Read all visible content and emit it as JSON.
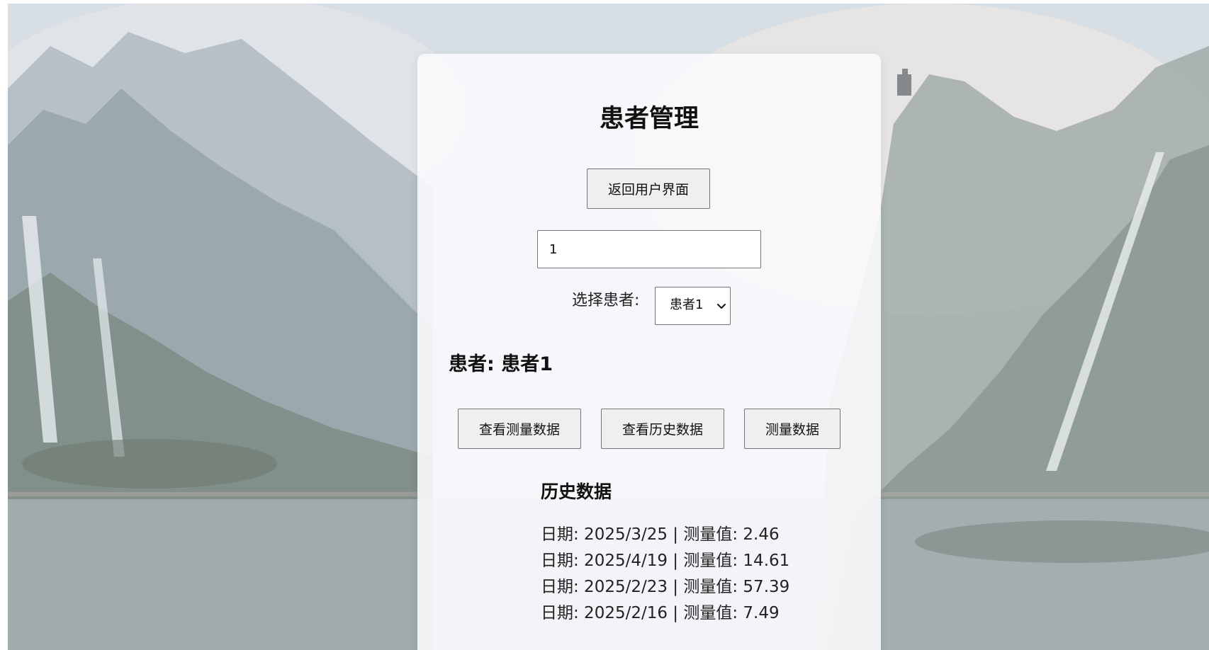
{
  "page": {
    "title": "患者管理"
  },
  "actions": {
    "back_label": "返回用户界面"
  },
  "id_input": {
    "value": "1"
  },
  "patient_select": {
    "label": "选择患者:",
    "selected": "患者1"
  },
  "patient": {
    "heading": "患者: 患者1"
  },
  "buttons": {
    "view_measurements": "查看测量数据",
    "view_history": "查看历史数据",
    "measure": "测量数据"
  },
  "history": {
    "heading": "历史数据",
    "entries": [
      "日期: 2025/3/25 | 测量值: 2.46",
      "日期: 2025/4/19 | 测量值: 14.61",
      "日期: 2025/2/23 | 测量值: 57.39",
      "日期: 2025/2/16 | 测量值: 7.49"
    ]
  },
  "icons": {
    "dropdown": "chevron-down-icon"
  }
}
